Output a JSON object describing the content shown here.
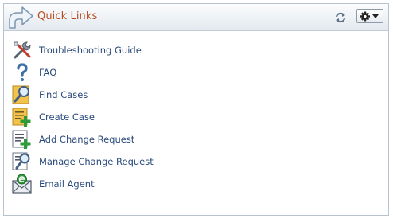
{
  "header": {
    "title": "Quick Links",
    "title_color": "#b84d1d",
    "icons": [
      "header-arrow-icon",
      "refresh-icon",
      "gear-icon",
      "caret-down-icon"
    ]
  },
  "links": [
    {
      "label": "Troubleshooting Guide",
      "icon": "tools-icon"
    },
    {
      "label": "FAQ",
      "icon": "question-mark-icon"
    },
    {
      "label": "Find Cases",
      "icon": "magnifier-icon"
    },
    {
      "label": "Create Case",
      "icon": "create-document-icon"
    },
    {
      "label": "Add Change Request",
      "icon": "add-document-icon"
    },
    {
      "label": "Manage Change Request",
      "icon": "manage-document-icon"
    },
    {
      "label": "Email Agent",
      "icon": "email-icon"
    }
  ],
  "colors": {
    "link": "#2a4a7c",
    "border": "#b9c3cf",
    "header_bg": "#eef2f6"
  }
}
